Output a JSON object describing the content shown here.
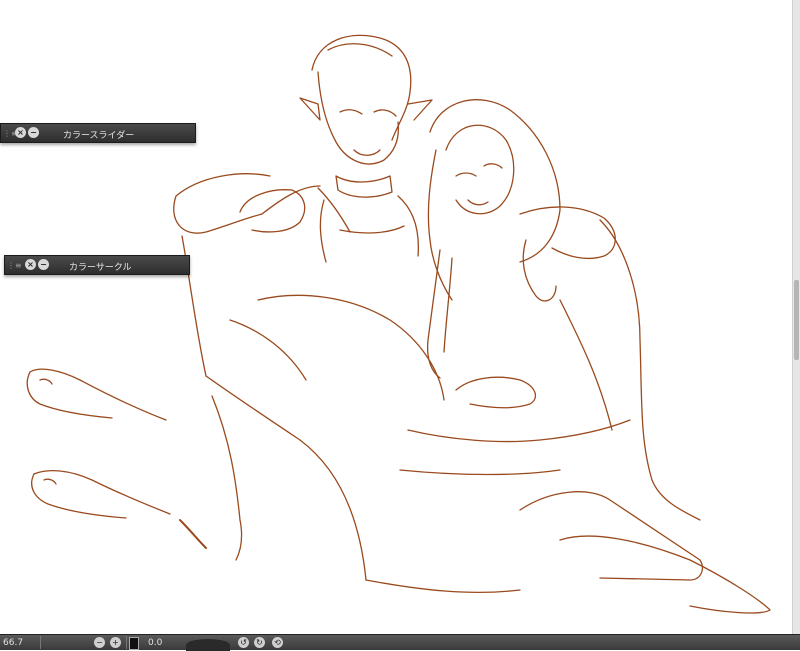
{
  "colors": {
    "line_art": "#9a4a1e",
    "panel_bg": "#3a3a3a",
    "statusbar_bg": "#4a4a4a"
  },
  "panels": {
    "color_slider": {
      "title": "カラースライダー"
    },
    "color_circle": {
      "title": "カラーサークル"
    }
  },
  "statusbar": {
    "zoom": "66.7",
    "rotation": "0.0"
  },
  "icons": [
    "close-icon",
    "minimize-icon",
    "grip-icon",
    "zoom-in-icon",
    "zoom-out-icon",
    "fit-icon"
  ]
}
